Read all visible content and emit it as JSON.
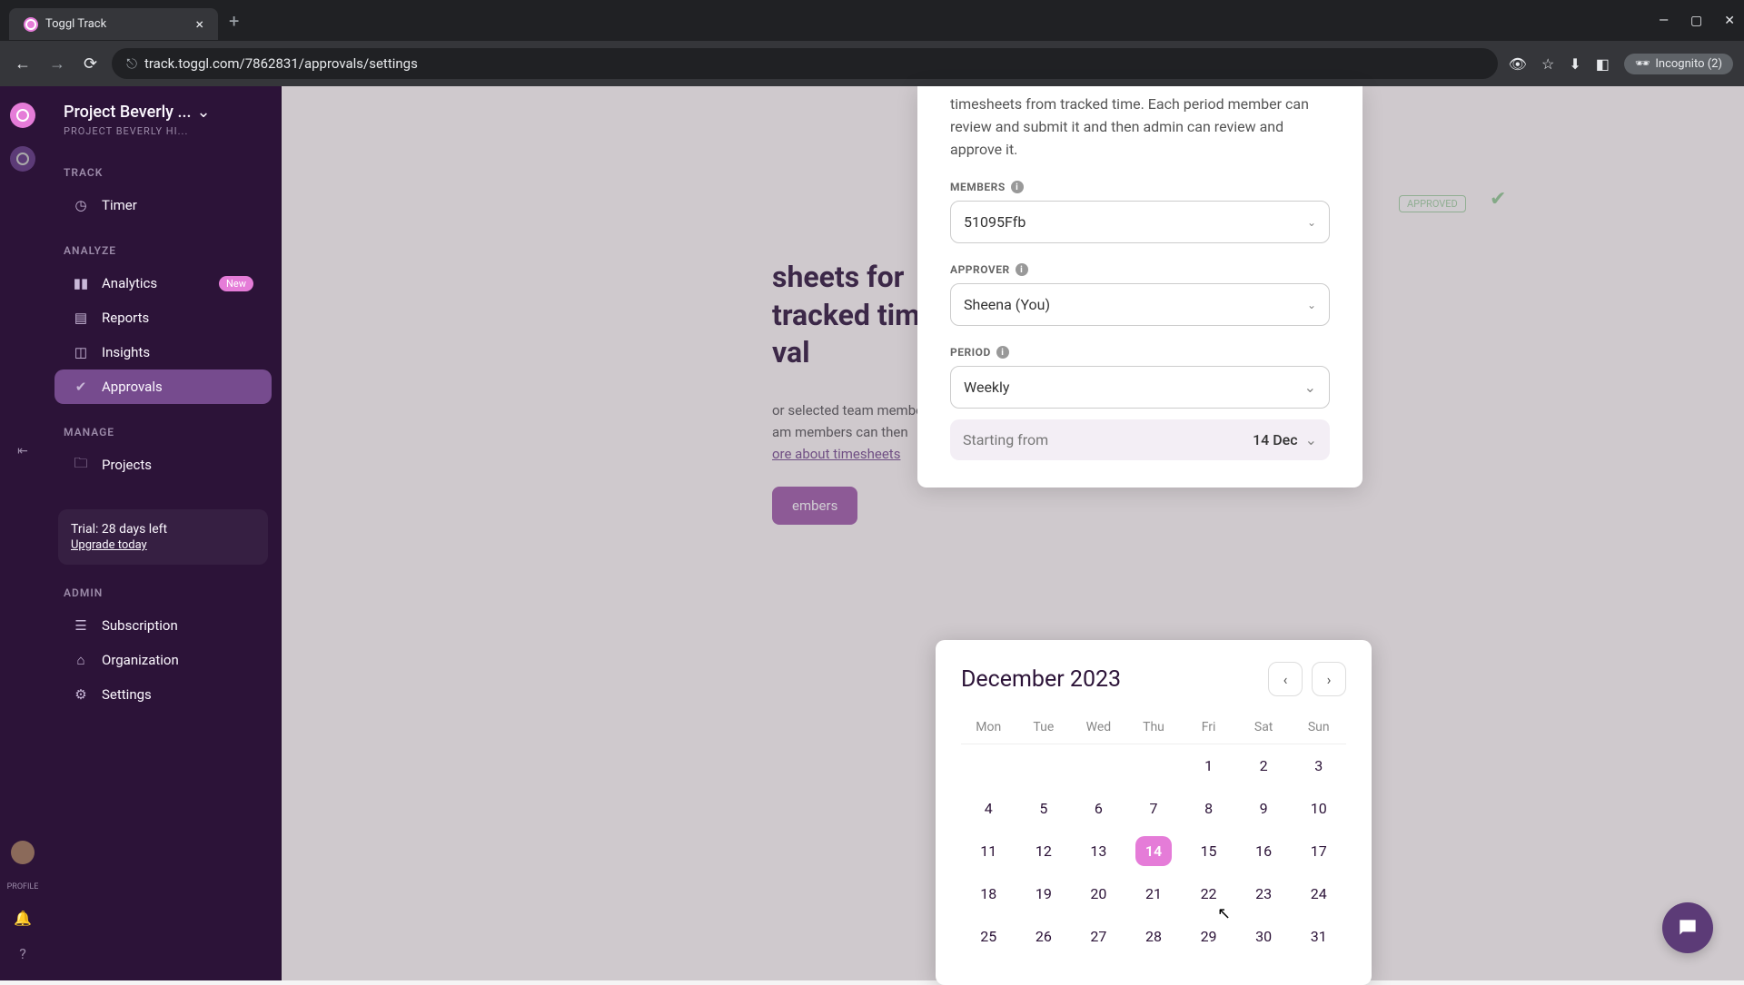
{
  "browser": {
    "tab_title": "Toggl Track",
    "url": "track.toggl.com/7862831/approvals/settings",
    "incognito": "Incognito (2)"
  },
  "workspace": {
    "name": "Project Beverly ...",
    "sub": "PROJECT BEVERLY HI..."
  },
  "sidebar": {
    "sections": {
      "track": "TRACK",
      "analyze": "ANALYZE",
      "manage": "MANAGE",
      "admin": "ADMIN"
    },
    "items": {
      "timer": "Timer",
      "analytics": "Analytics",
      "analytics_badge": "New",
      "reports": "Reports",
      "insights": "Insights",
      "approvals": "Approvals",
      "projects": "Projects",
      "subscription": "Subscription",
      "organization": "Organization",
      "settings": "Settings"
    },
    "trial": {
      "text": "Trial: 28 days left",
      "link": "Upgrade today"
    },
    "profile_label": "PROFILE"
  },
  "background": {
    "title_1": "sheets for",
    "title_2": "tracked time",
    "title_3": "val",
    "desc_1": "or selected team members",
    "desc_2": "am members can then",
    "link": "ore about timesheets",
    "button": "embers",
    "approved": "APPROVED"
  },
  "modal": {
    "intro": "timesheets from tracked time. Each period member can review and submit it and then admin can review and approve it.",
    "members_label": "MEMBERS",
    "members_value": "51095Ffb",
    "approver_label": "APPROVER",
    "approver_value": "Sheena (You)",
    "period_label": "PERIOD",
    "period_value": "Weekly",
    "starting_label": "Starting from",
    "starting_value": "14 Dec"
  },
  "calendar": {
    "title": "December 2023",
    "prev": "‹",
    "next": "›",
    "dow": [
      "Mon",
      "Tue",
      "Wed",
      "Thu",
      "Fri",
      "Sat",
      "Sun"
    ],
    "days": [
      "",
      "",
      "",
      "",
      "1",
      "2",
      "3",
      "4",
      "5",
      "6",
      "7",
      "8",
      "9",
      "10",
      "11",
      "12",
      "13",
      "14",
      "15",
      "16",
      "17",
      "18",
      "19",
      "20",
      "21",
      "22",
      "23",
      "24",
      "25",
      "26",
      "27",
      "28",
      "29",
      "30",
      "31"
    ],
    "selected": "14"
  }
}
